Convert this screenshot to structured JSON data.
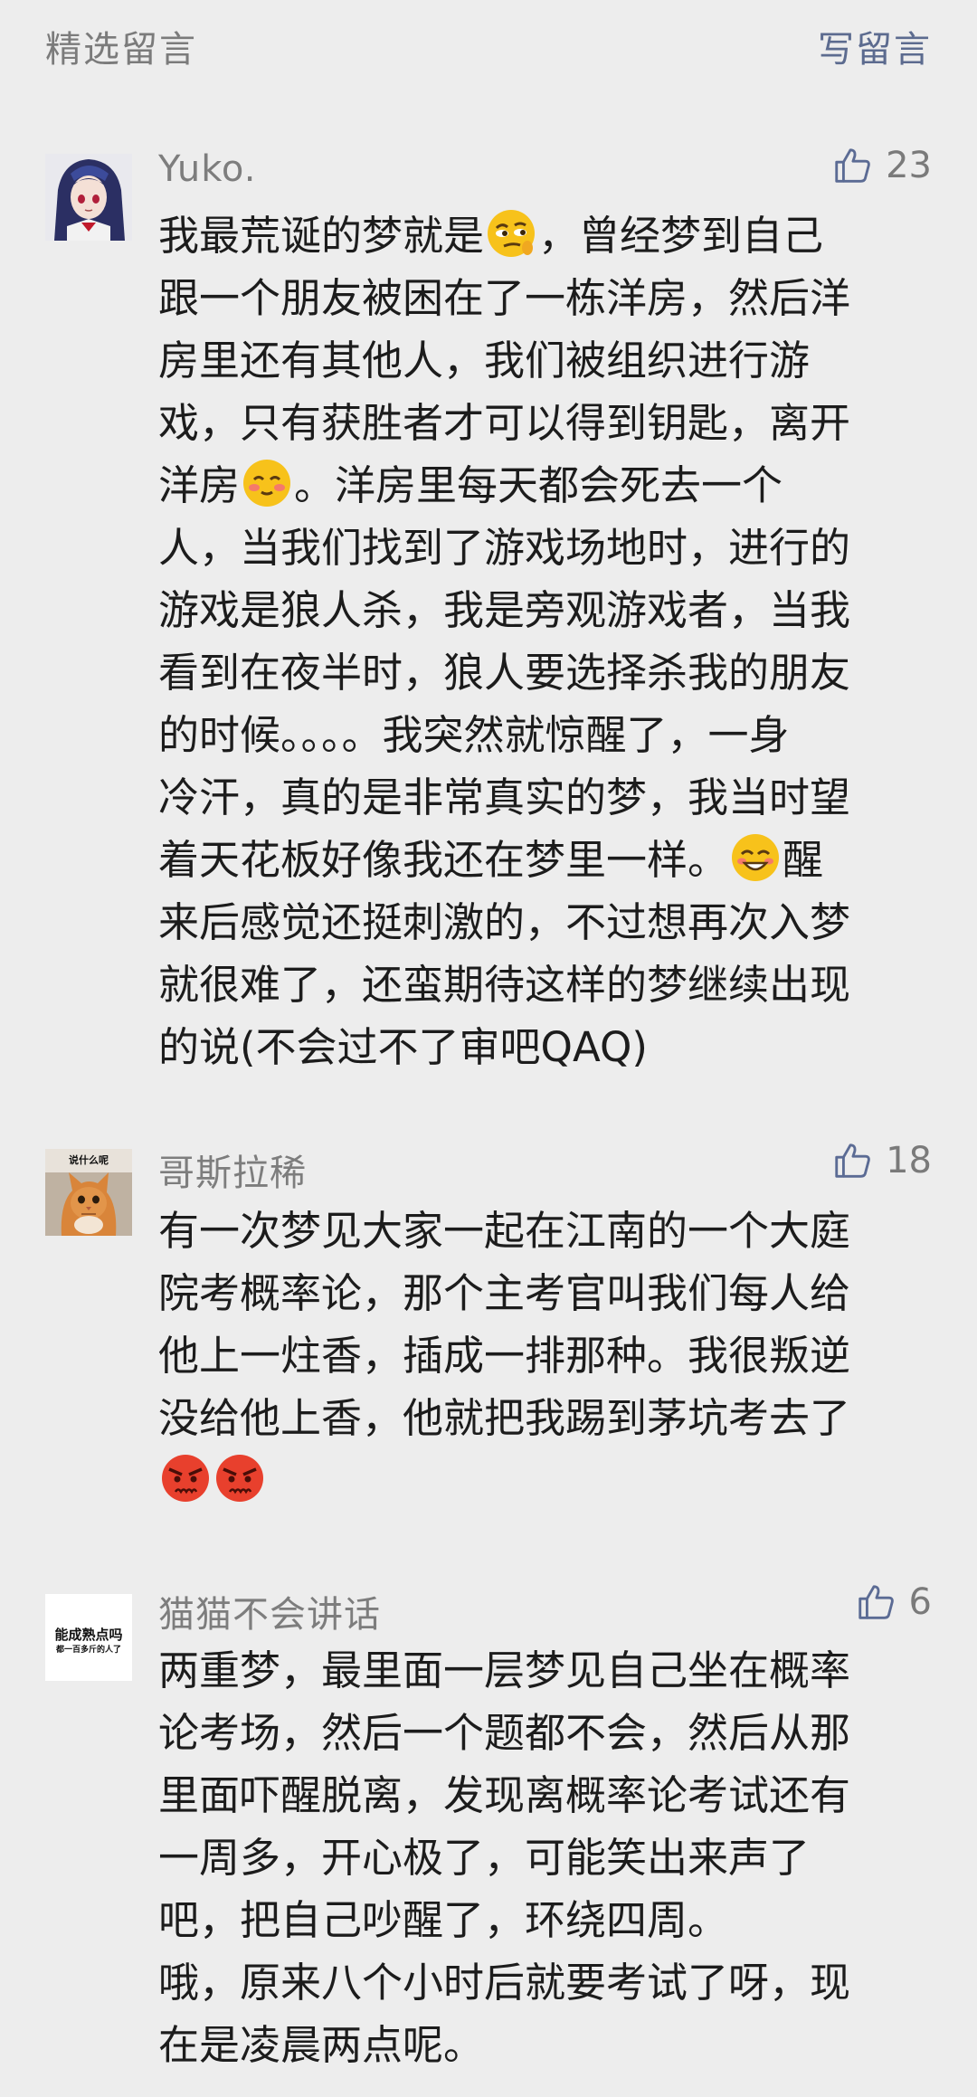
{
  "header": {
    "section_title": "精选留言",
    "write_comment": "写留言"
  },
  "comments": [
    {
      "nickname": "Yuko.",
      "likes": "23",
      "lines": {
        "l1a": "我最荒诞的梦就是",
        "l1b": "，曾经梦到自己",
        "l2": "跟一个朋友被困在了一栋洋房，然后洋",
        "l3": "房里还有其他人，我们被组织进行游",
        "l4": "戏，只有获胜者才可以得到钥匙，离开",
        "l5a": "洋房",
        "l5b": "。洋房里每天都会死去一个",
        "l6": "人，当我们找到了游戏场地时，进行的",
        "l7": "游戏是狼人杀，我是旁观游戏者，当我",
        "l8": "看到在夜半时，狼人要选择杀我的朋友",
        "l9": "的时候。。。。我突然就惊醒了，一身",
        "l10": "冷汗，真的是非常真实的梦，我当时望",
        "l11a": "着天花板好像我还在梦里一样。",
        "l11b": "醒",
        "l12": "来后感觉还挺刺激的，不过想再次入梦",
        "l13": "就很难了，还蛮期待这样的梦继续出现",
        "l14": "的说(不会过不了审吧QAQ)"
      },
      "emojis": [
        "skeptical-face-emoji",
        "blushing-smile-emoji",
        "grinning-smile-emoji"
      ]
    },
    {
      "nickname": "哥斯拉稀",
      "likes": "18",
      "avatar_caption": "说什么呢",
      "lines": {
        "l1": "有一次梦见大家一起在江南的一个大庭",
        "l2": "院考概率论，那个主考官叫我们每人给",
        "l3": "他上一炷香，插成一排那种。我很叛逆",
        "l4": "没给他上香，他就把我踢到茅坑考去了"
      },
      "emojis": [
        "angry-face-emoji",
        "angry-face-emoji"
      ]
    },
    {
      "nickname": "猫猫不会讲话",
      "likes": "6",
      "avatar_caption_1": "能成熟点吗",
      "avatar_caption_2": "都一百多斤的人了",
      "lines": {
        "l1": "两重梦，最里面一层梦见自己坐在概率",
        "l2": "论考场，然后一个题都不会，然后从那",
        "l3": "里面吓醒脱离，发现离概率论考试还有",
        "l4": "一周多，开心极了，可能笑出来声了",
        "l5": "吧，把自己吵醒了，环绕四周。",
        "l6": "哦，原来八个小时后就要考试了呀，现",
        "l7": "在是凌晨两点呢。"
      }
    }
  ],
  "colors": {
    "background": "#ededed",
    "link": "#5c6b8f",
    "muted": "#7b7b7b",
    "text": "#1c1c1c",
    "emoji_yellow": "#f7c21b",
    "emoji_red": "#e8402d"
  }
}
